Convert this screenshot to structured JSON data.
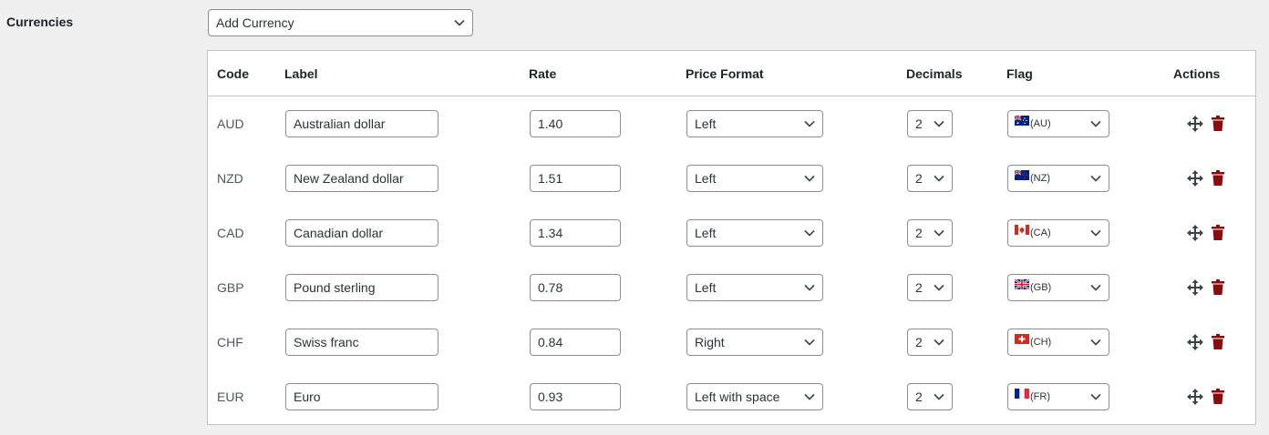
{
  "section": {
    "label": "Currencies"
  },
  "add_currency": {
    "label": "Add Currency"
  },
  "table": {
    "headers": {
      "code": "Code",
      "label": "Label",
      "rate": "Rate",
      "price_format": "Price Format",
      "decimals": "Decimals",
      "flag": "Flag",
      "actions": "Actions"
    },
    "rows": [
      {
        "code": "AUD",
        "label": "Australian dollar",
        "rate": "1.40",
        "format": "Left",
        "decimals": "2",
        "flag": "(AU)",
        "flag_icon": "australia-flag-icon"
      },
      {
        "code": "NZD",
        "label": "New Zealand dollar",
        "rate": "1.51",
        "format": "Left",
        "decimals": "2",
        "flag": "(NZ)",
        "flag_icon": "new-zealand-flag-icon"
      },
      {
        "code": "CAD",
        "label": "Canadian dollar",
        "rate": "1.34",
        "format": "Left",
        "decimals": "2",
        "flag": "(CA)",
        "flag_icon": "canada-flag-icon"
      },
      {
        "code": "GBP",
        "label": "Pound sterling",
        "rate": "0.78",
        "format": "Left",
        "decimals": "2",
        "flag": "(GB)",
        "flag_icon": "united-kingdom-flag-icon"
      },
      {
        "code": "CHF",
        "label": "Swiss franc",
        "rate": "0.84",
        "format": "Right",
        "decimals": "2",
        "flag": "(CH)",
        "flag_icon": "switzerland-flag-icon"
      },
      {
        "code": "EUR",
        "label": "Euro",
        "rate": "0.93",
        "format": "Left with space",
        "decimals": "2",
        "flag": "(FR)",
        "flag_icon": "france-flag-icon"
      }
    ]
  },
  "icons": {
    "move": "move-icon",
    "delete": "trash-icon",
    "dropdown": "chevron-down-icon"
  },
  "colors": {
    "background": "#f0f0f1",
    "border": "#c3c4c7",
    "input_border": "#8c8f94",
    "trash": "#8a0b0b",
    "move": "#3c434a"
  }
}
